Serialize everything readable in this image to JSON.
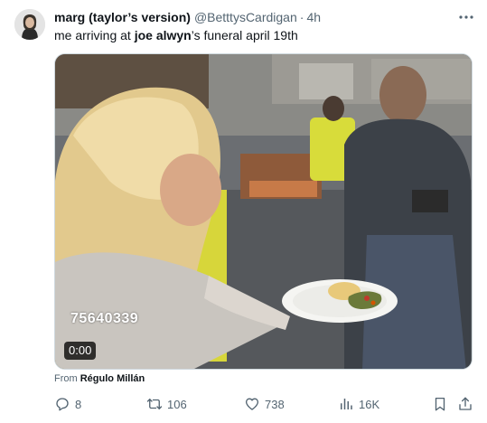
{
  "tweet": {
    "author": {
      "display_name": "marg (taylor’s version)",
      "handle": "@BetttysCardigan",
      "separator": "·",
      "time_ago": "4h"
    },
    "text": {
      "prefix": "me arriving at ",
      "bold": "joe alwyn",
      "suffix": "’s funeral april 19th"
    },
    "media": {
      "overlay_id": "75640339",
      "duration": "0:00"
    },
    "attribution": {
      "prefix": "From ",
      "source": "Régulo Millán"
    },
    "actions": {
      "replies": "8",
      "reposts": "106",
      "likes": "738",
      "views": "16K"
    }
  },
  "icons": {
    "more": "more-horizontal-icon",
    "reply": "reply-bubble-icon",
    "repost": "repost-arrows-icon",
    "like": "heart-icon",
    "views": "analytics-bars-icon",
    "bookmark": "bookmark-icon",
    "share": "share-icon"
  },
  "colors": {
    "text_primary": "#0f1419",
    "text_secondary": "#536471",
    "border": "#cfd9de"
  }
}
